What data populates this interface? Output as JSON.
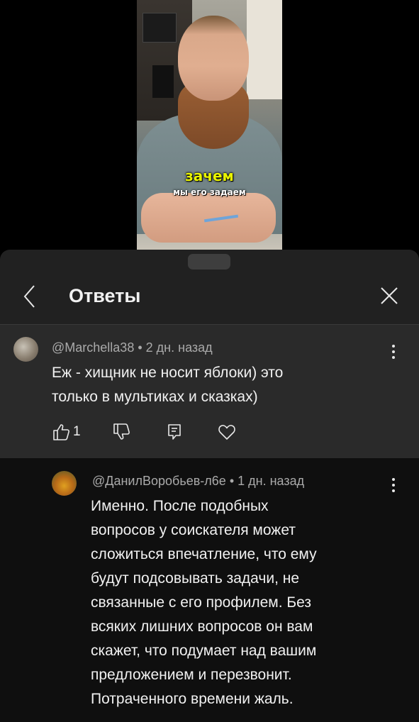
{
  "video": {
    "caption_top": "зачем",
    "caption_bottom": "мы его задаем"
  },
  "header": {
    "title": "Ответы"
  },
  "comments": [
    {
      "author": "@Marchella38",
      "time": "2 дн. назад",
      "text_lines": [
        "Еж - хищник не носит яблоки) это",
        "только в мультиках и сказках)"
      ],
      "likes": "1"
    },
    {
      "author": "@ДанилВоробьев-л6е",
      "time": "1 дн. назад",
      "text_lines": [
        "Именно. После подобных",
        "вопросов у соискателя может",
        "сложиться впечатление, что ему",
        "будут подсовывать задачи, не",
        "связанные с его профилем. Без",
        "всяких лишних вопросов он вам",
        "скажет, что подумает над вашим",
        "предложением и перезвонит.",
        "Потраченного времени жаль."
      ]
    }
  ],
  "meta_separator": "•",
  "icons": {
    "back": "chevron-left-icon",
    "close": "close-icon",
    "more": "more-vert-icon",
    "like": "thumb-up-icon",
    "dislike": "thumb-down-icon",
    "reply": "reply-icon",
    "heart": "heart-icon"
  }
}
